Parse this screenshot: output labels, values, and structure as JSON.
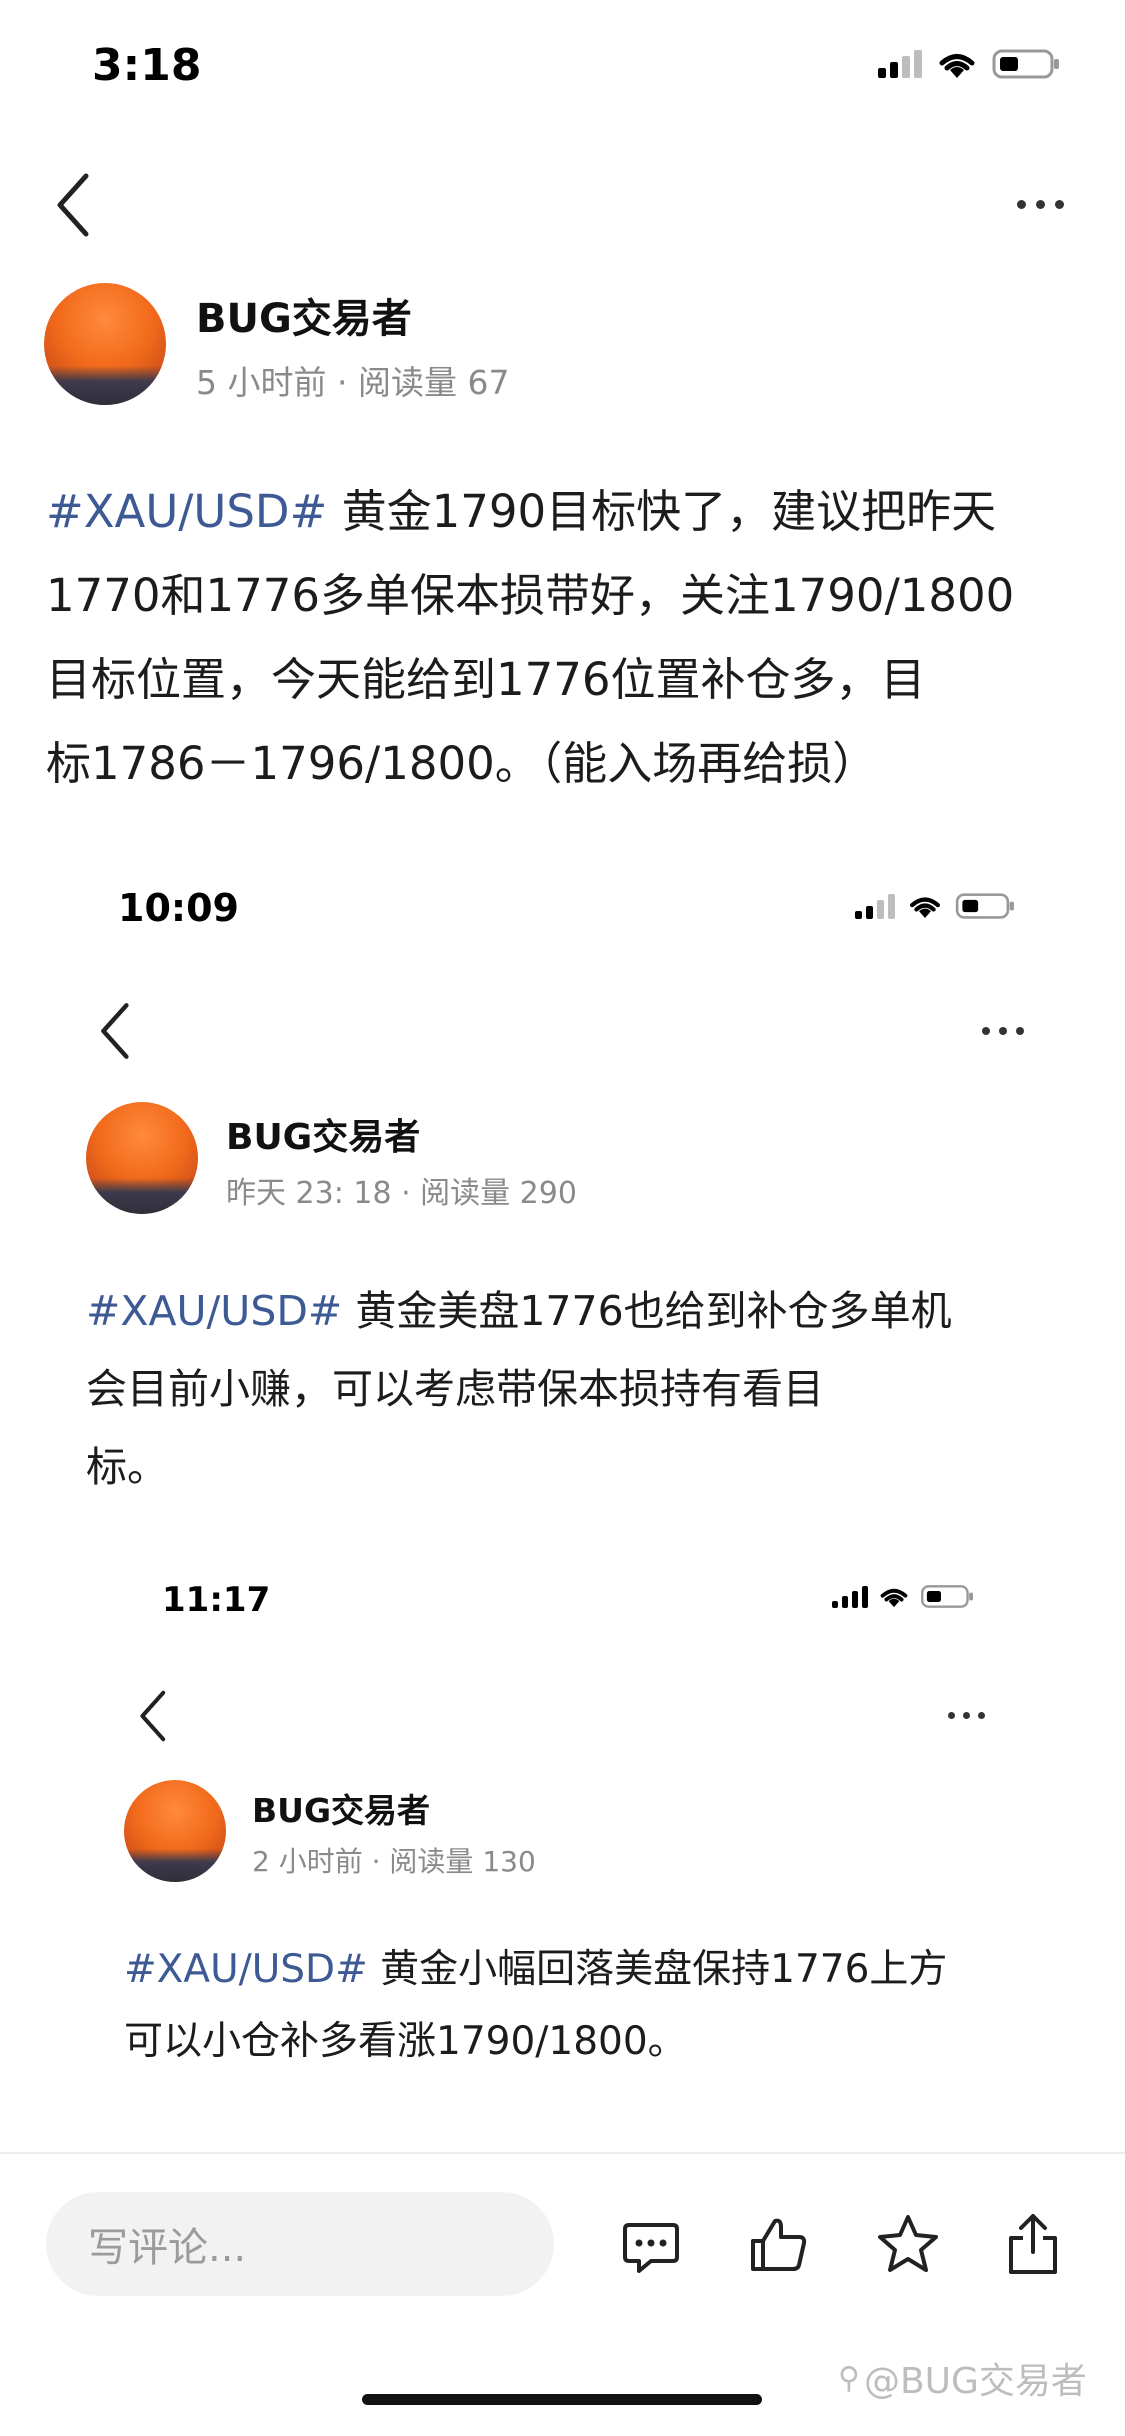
{
  "screens": [
    {
      "status_time": "3:18",
      "author": "BUG交易者",
      "meta": "5 小时前 · 阅读量 67",
      "tag": "#XAU/USD#",
      "lines": [
        " 黄金1790目标快了，建议把昨天",
        "1770和1776多单保本损带好，关注1790/1800",
        "目标位置，今天能给到1776位置补仓多，目",
        "标1786－1796/1800。（能入场再给损）"
      ]
    },
    {
      "status_time": "10:09",
      "author": "BUG交易者",
      "meta": "昨天 23: 18 · 阅读量 290",
      "tag": "#XAU/USD#",
      "lines": [
        " 黄金美盘1776也给到补仓多单机",
        "会目前小赚，可以考虑带保本损持有看目",
        "标。"
      ]
    },
    {
      "status_time": "11:17",
      "author": "BUG交易者",
      "meta": "2 小时前 · 阅读量 130",
      "tag": "#XAU/USD#",
      "lines": [
        " 黄金小幅回落美盘保持1776上方",
        "可以小仓补多看涨1790/1800。"
      ]
    }
  ],
  "bottom_bar": {
    "comment_placeholder": "写评论...",
    "icons": [
      "comment-icon",
      "like-icon",
      "star-icon",
      "share-icon"
    ]
  },
  "watermark": "@BUG交易者",
  "colors": {
    "tag": "#3d5a94",
    "meta": "#8a8a8a"
  }
}
